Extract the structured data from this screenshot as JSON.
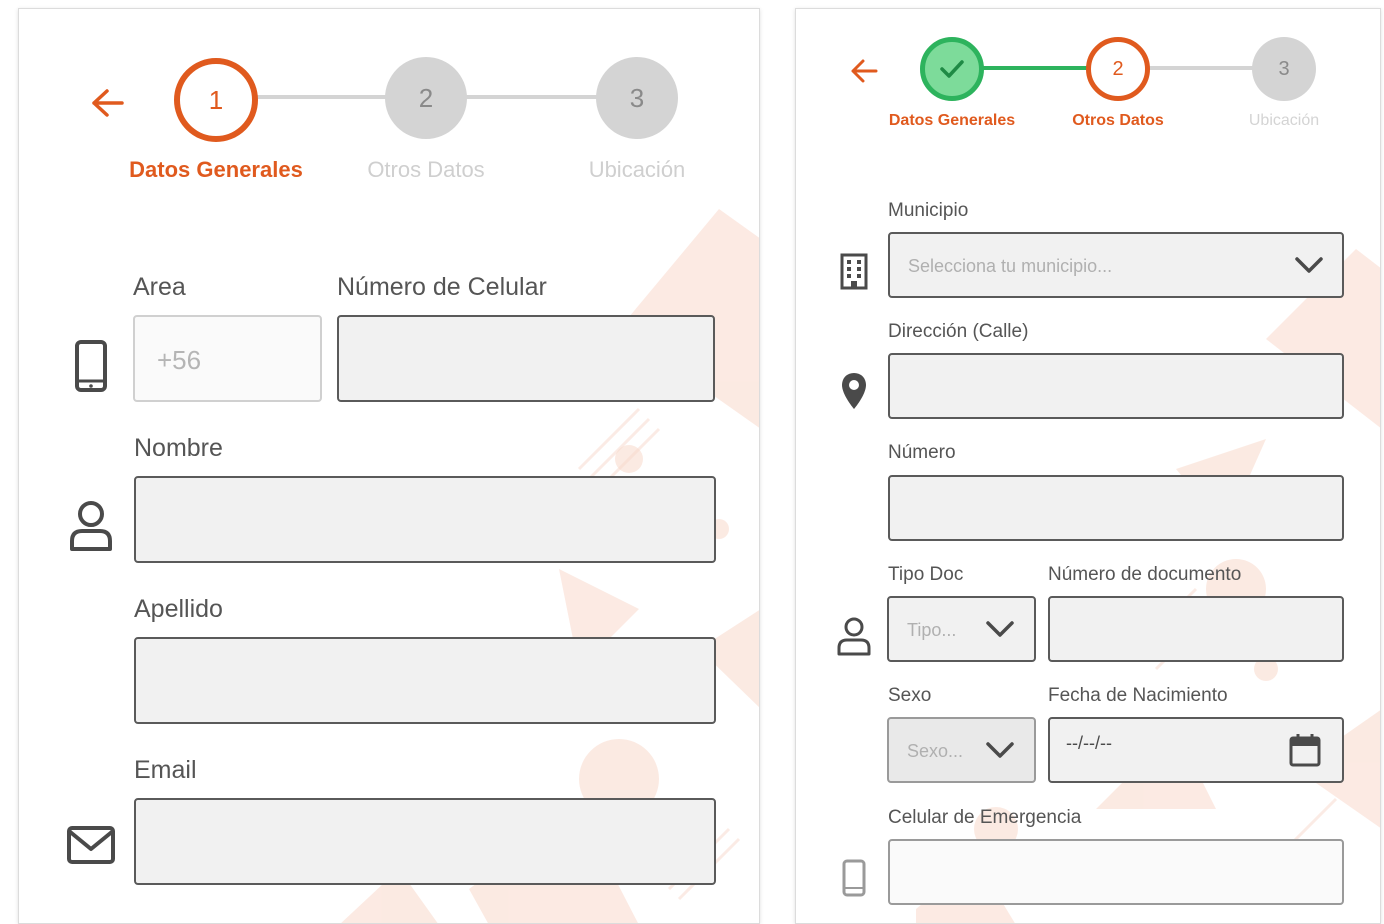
{
  "left_screen": {
    "stepper": {
      "steps": [
        {
          "number": "1",
          "label": "Datos Generales",
          "state": "active"
        },
        {
          "number": "2",
          "label": "Otros Datos",
          "state": "pending"
        },
        {
          "number": "3",
          "label": "Ubicación",
          "state": "pending"
        }
      ]
    },
    "form": {
      "area_label": "Area",
      "area_value": "+56",
      "phone_label": "Número de Celular",
      "phone_value": "",
      "name_label": "Nombre",
      "lastname_label": "Apellido",
      "email_label": "Email"
    },
    "icons": {
      "back": "arrow-left-icon",
      "phone": "smartphone-icon",
      "user": "user-icon",
      "email": "envelope-icon"
    }
  },
  "right_screen": {
    "stepper": {
      "steps": [
        {
          "number": "",
          "label": "Datos Generales",
          "state": "completed"
        },
        {
          "number": "2",
          "label": "Otros Datos",
          "state": "active"
        },
        {
          "number": "3",
          "label": "Ubicación",
          "state": "pending"
        }
      ]
    },
    "form": {
      "municipio_label": "Municipio",
      "municipio_placeholder": "Selecciona tu municipio...",
      "direccion_label": "Dirección (Calle)",
      "numero_label": "Número",
      "tipo_doc_label": "Tipo Doc",
      "tipo_doc_placeholder": "Tipo...",
      "numero_doc_label": "Número de documento",
      "sexo_label": "Sexo",
      "sexo_placeholder": "Sexo...",
      "fecha_label": "Fecha de Nacimiento",
      "fecha_placeholder": "--/--/--",
      "celular_emergencia_label": "Celular de Emergencia"
    },
    "icons": {
      "back": "arrow-left-icon",
      "building": "building-icon",
      "location": "map-pin-icon",
      "user": "user-icon",
      "calendar": "calendar-icon",
      "phone": "smartphone-icon",
      "check": "check-icon",
      "dropdown": "chevron-down-icon"
    }
  },
  "colors": {
    "accent": "#e05a1e",
    "success": "#2db35d",
    "pending_circle": "#d4d4d4",
    "pending_text": "#c9c9c9",
    "field_bg": "#f1f1f1",
    "field_border": "#5a5a5a"
  }
}
